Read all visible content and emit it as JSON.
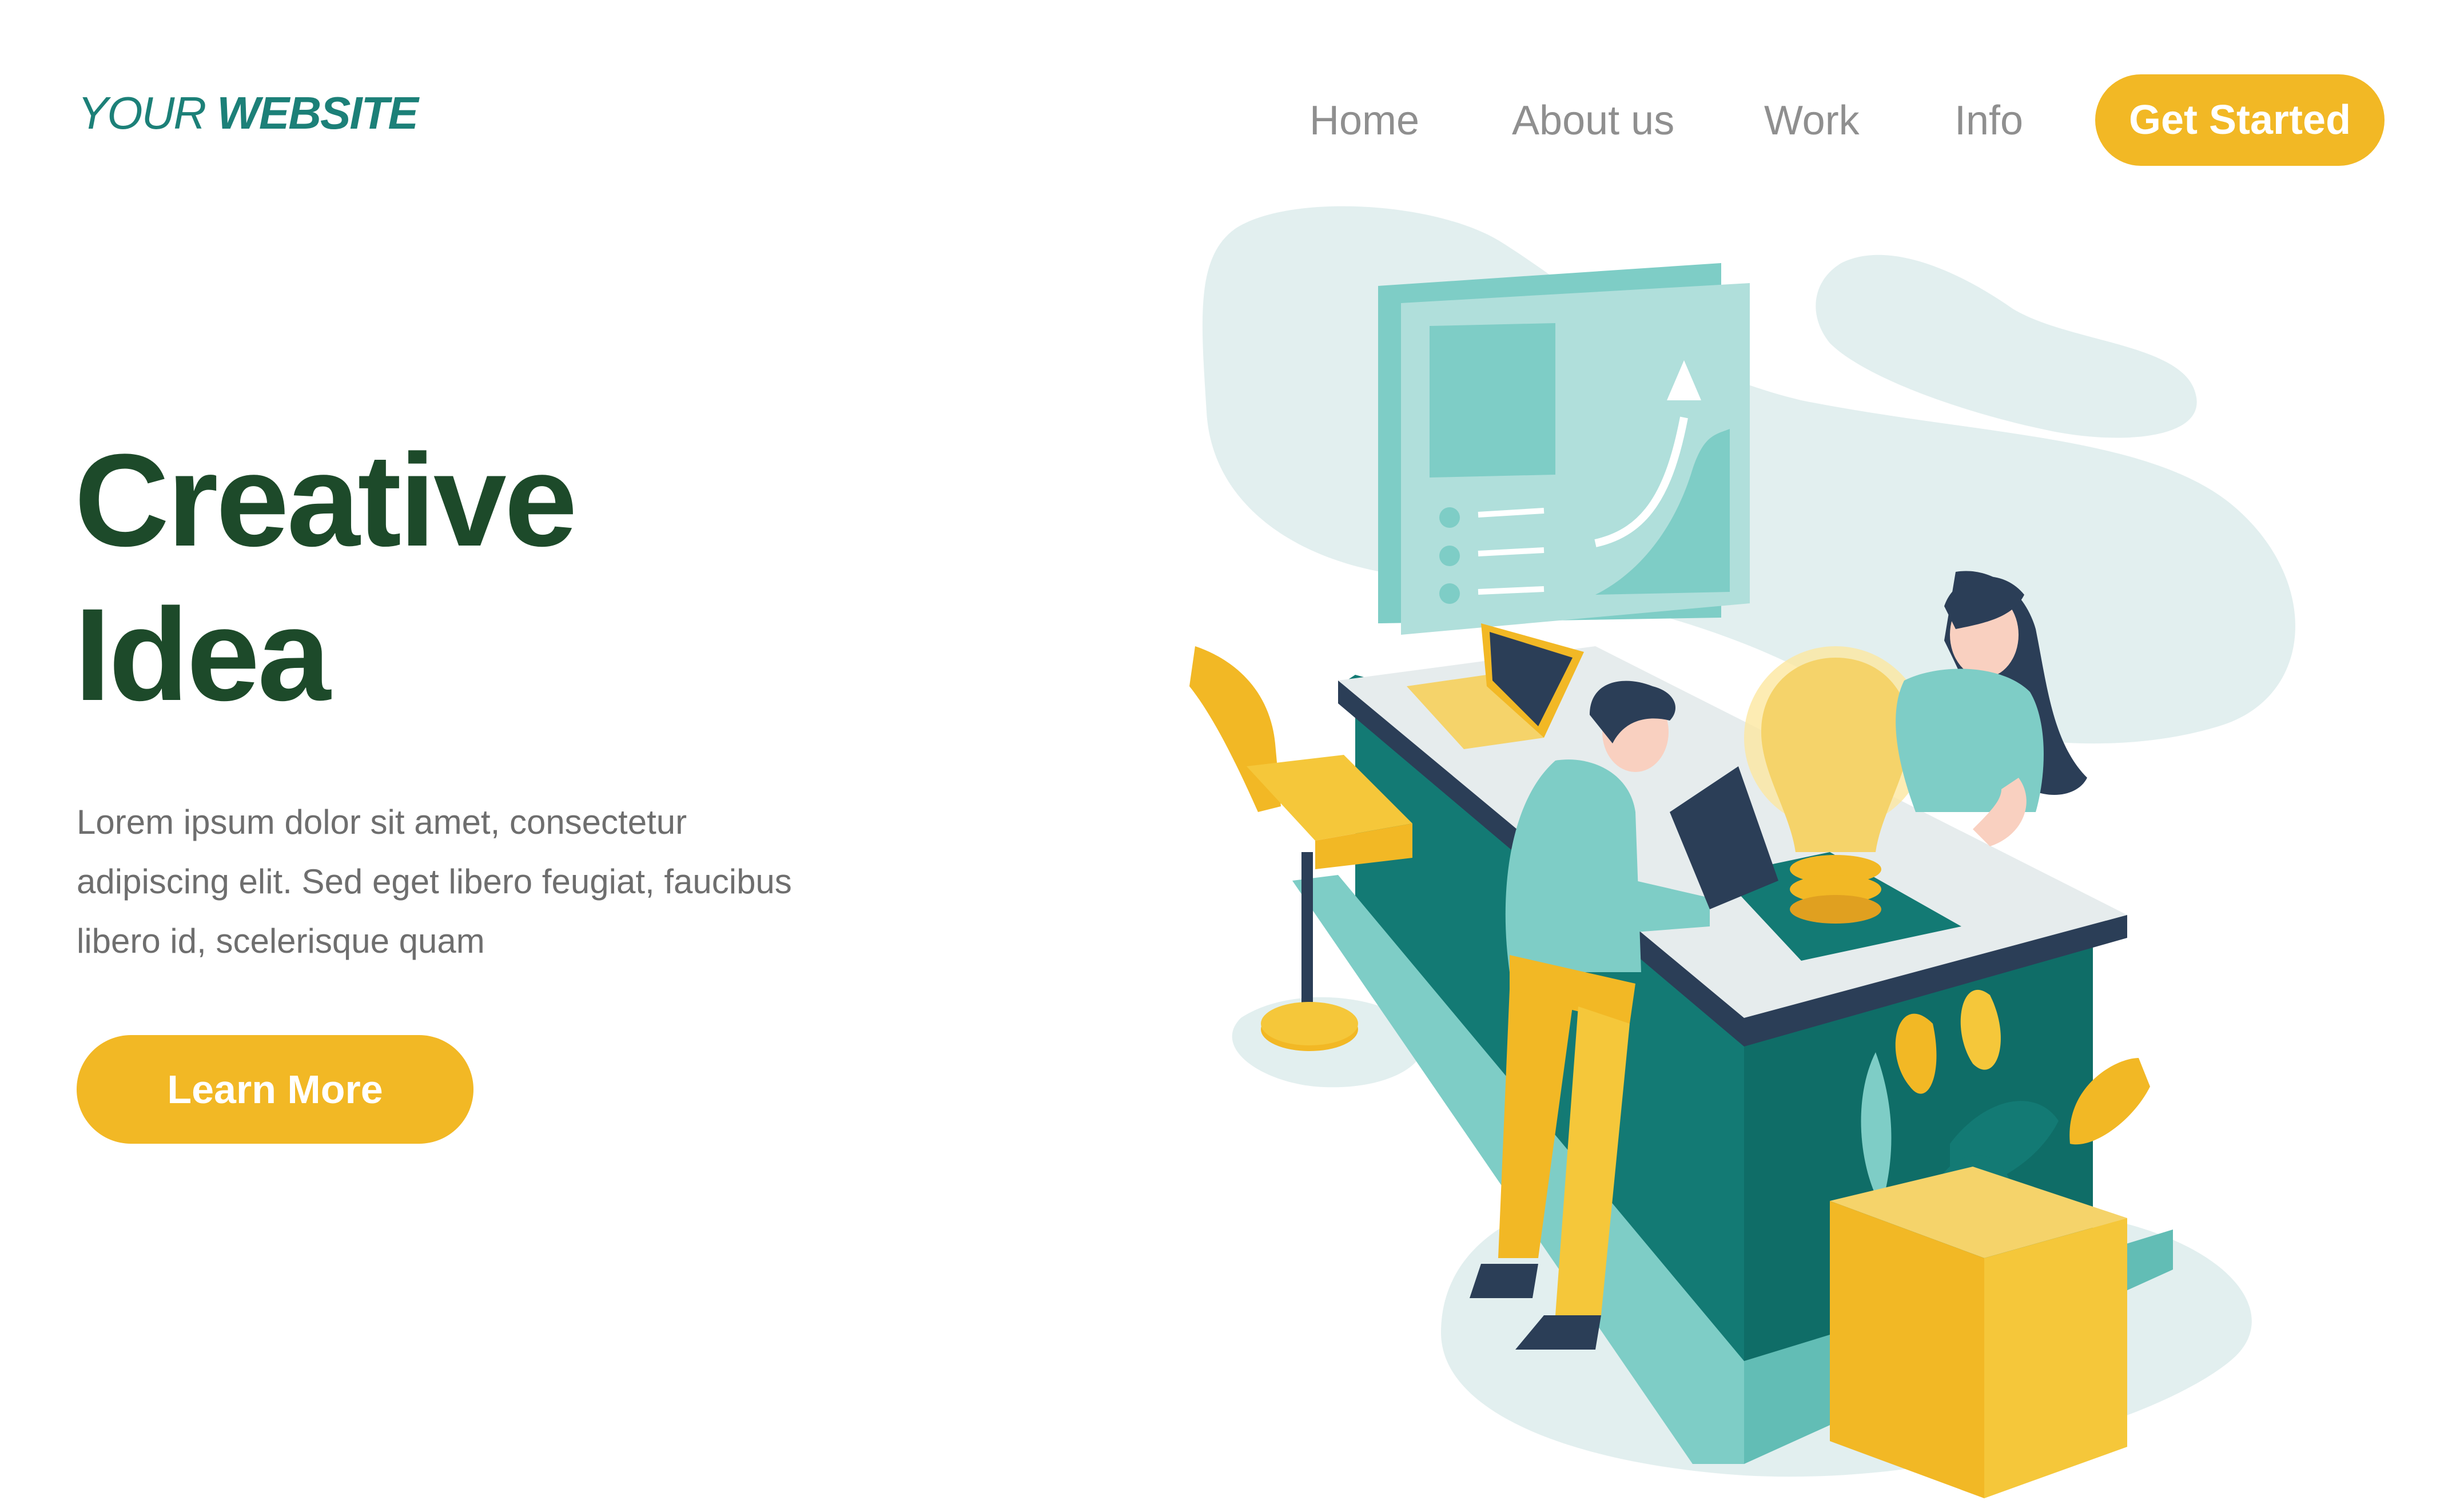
{
  "brand": {
    "prefix": "YOUR",
    "name": "WEBSITE"
  },
  "nav": {
    "items": [
      {
        "label": "Home"
      },
      {
        "label": "About us"
      },
      {
        "label": "Work"
      },
      {
        "label": "Info"
      }
    ],
    "cta": "Get Started"
  },
  "hero": {
    "title_line1": "Creative",
    "title_line2": "Idea",
    "body_lines": [
      "Lorem ipsum dolor sit amet, consectetur",
      "adipiscing elit. Sed eget libero feugiat, faucibus",
      "libero id, scelerisque quam"
    ],
    "button": "Learn More"
  },
  "colors": {
    "brand_teal": "#1c8078",
    "title_green": "#1d4a2a",
    "accent_yellow": "#f2b825",
    "nav_gray": "#8f8f8f",
    "body_gray": "#6e6e6e",
    "light_teal": "#7ecdc6",
    "dark_teal": "#137a74",
    "navy": "#2b3e57"
  }
}
